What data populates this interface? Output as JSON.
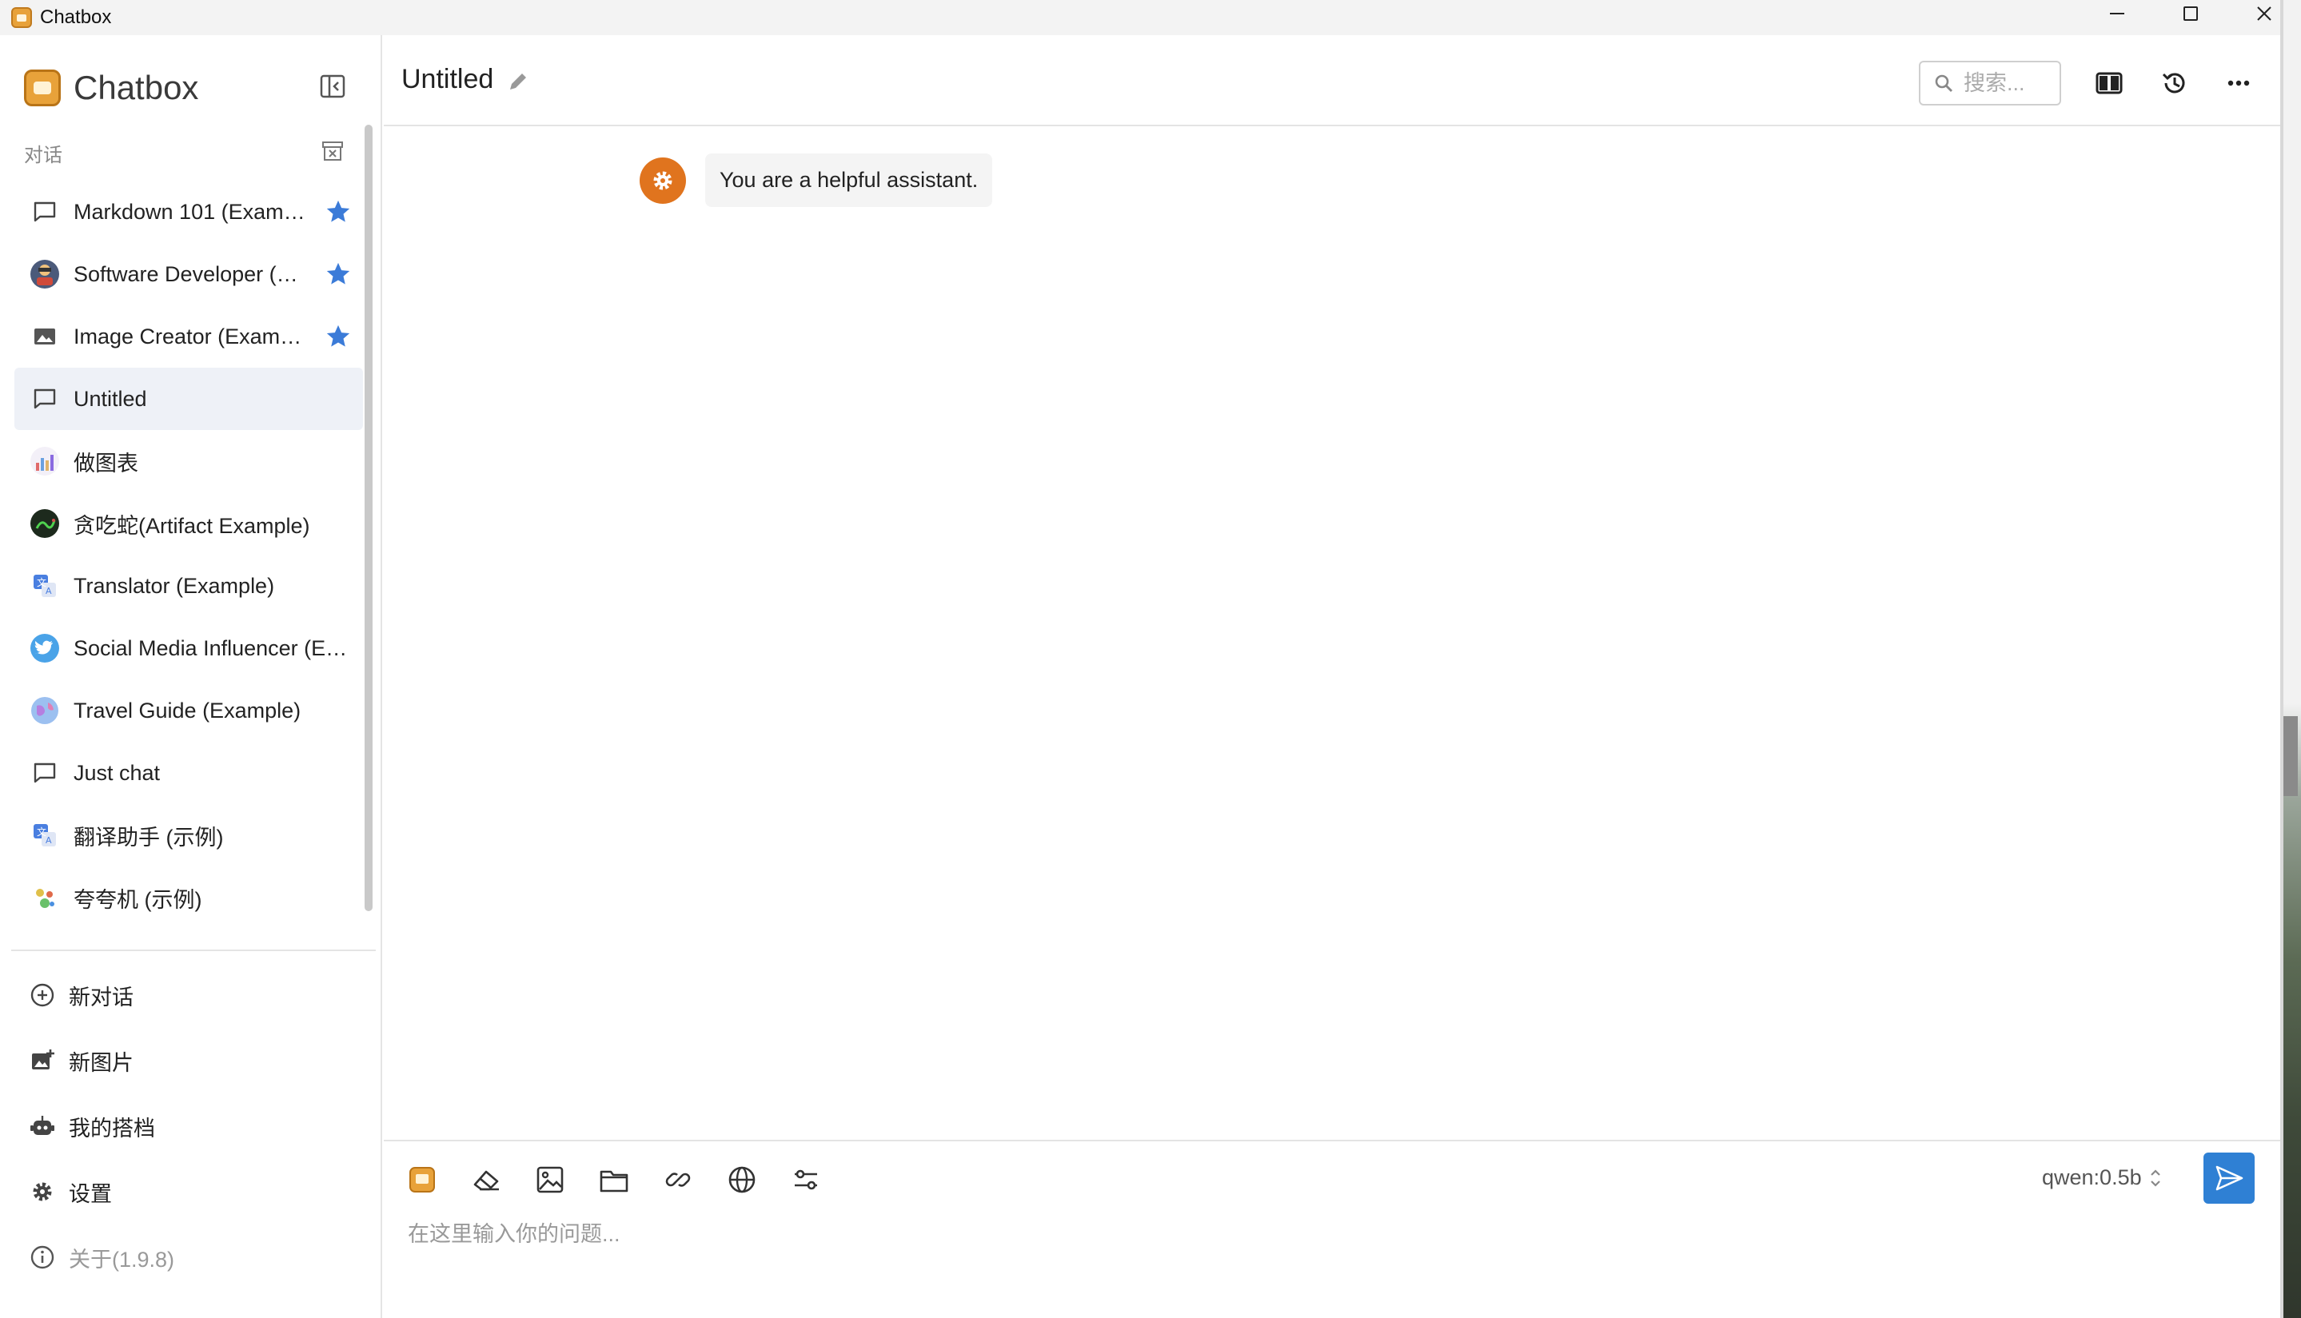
{
  "window": {
    "title": "Chatbox"
  },
  "sidebar": {
    "brand": "Chatbox",
    "section_label": "对话",
    "conversations": [
      {
        "label": "Markdown 101 (Example)",
        "icon": "chat-bubble-icon",
        "starred": true
      },
      {
        "label": "Software Developer (Example)",
        "icon": "developer-avatar",
        "starred": true
      },
      {
        "label": "Image Creator (Example)",
        "icon": "image-icon",
        "starred": true
      },
      {
        "label": "Untitled",
        "icon": "chat-bubble-icon",
        "starred": false,
        "active": true
      },
      {
        "label": "做图表",
        "icon": "chart-avatar",
        "starred": false
      },
      {
        "label": "贪吃蛇(Artifact Example)",
        "icon": "snake-game-avatar",
        "starred": false
      },
      {
        "label": "Translator (Example)",
        "icon": "translate-avatar",
        "starred": false
      },
      {
        "label": "Social Media Influencer (Example)",
        "icon": "twitter-avatar",
        "starred": false
      },
      {
        "label": "Travel Guide (Example)",
        "icon": "globe-avatar",
        "starred": false
      },
      {
        "label": "Just chat",
        "icon": "chat-bubble-icon",
        "starred": false
      },
      {
        "label": "翻译助手 (示例)",
        "icon": "translate-avatar",
        "starred": false
      },
      {
        "label": "夸夸机 (示例)",
        "icon": "cheer-avatar",
        "starred": false
      }
    ],
    "nav": {
      "new_chat": "新对话",
      "new_image": "新图片",
      "my_copilots": "我的搭档",
      "settings": "设置",
      "about": "关于(1.9.8)"
    }
  },
  "header": {
    "title": "Untitled",
    "search_placeholder": "搜索..."
  },
  "messages": [
    {
      "role": "system",
      "text": "You are a helpful assistant."
    }
  ],
  "composer": {
    "placeholder": "在这里输入你的问题...",
    "model": "qwen:0.5b"
  },
  "colors": {
    "accent_blue": "#2f80d4",
    "star_blue": "#3b7bd8",
    "system_avatar": "#e0741e",
    "brand_orange": "#e8a23a",
    "active_row": "#eef1f7"
  }
}
